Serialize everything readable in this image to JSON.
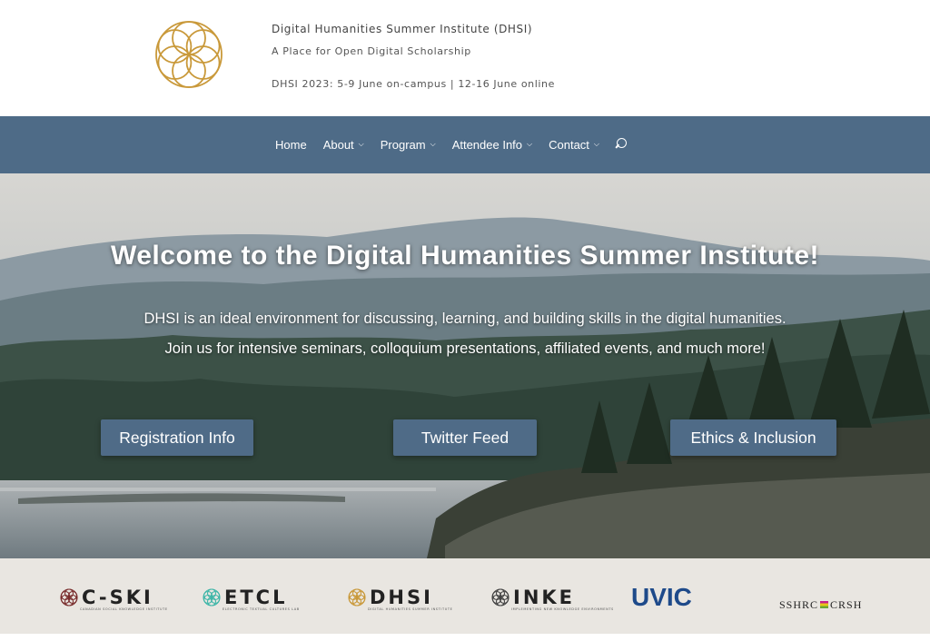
{
  "header": {
    "title": "Digital Humanities Summer Institute (DHSI)",
    "tagline": "A Place for Open Digital Scholarship",
    "dates": "DHSI 2023: 5-9 June on-campus | 12-16 June online",
    "logo_icon": "flower-of-life-logo-icon",
    "logo_color": "#c9993a"
  },
  "nav": {
    "background": "#4e6b87",
    "items": [
      {
        "label": "Home",
        "dropdown": false
      },
      {
        "label": "About",
        "dropdown": true
      },
      {
        "label": "Program",
        "dropdown": true
      },
      {
        "label": "Attendee Info",
        "dropdown": true
      },
      {
        "label": "Contact",
        "dropdown": true
      }
    ],
    "search_icon": "search-icon"
  },
  "hero": {
    "title": "Welcome to the Digital Humanities Summer Institute!",
    "line1": "DHSI is an ideal environment for discussing, learning, and building skills in the digital humanities.",
    "line2": "Join us for intensive seminars, colloquium presentations, affiliated events, and much more!",
    "buttons": {
      "registration": "Registration Info",
      "twitter": "Twitter Feed",
      "ethics": "Ethics & Inclusion"
    },
    "button_color": "#4f6b87"
  },
  "partners": {
    "cski": {
      "name": "C-SKI",
      "sub": "CANADIAN SOCIAL KNOWLEDGE INSTITUTE"
    },
    "etcl": {
      "name": "ETCL",
      "sub": "ELECTRONIC TEXTUAL CULTURES LAB"
    },
    "dhsi": {
      "name": "DHSI",
      "sub": "DIGITAL HUMANITIES SUMMER INSTITUTE"
    },
    "inke": {
      "name": "INKE",
      "sub": "IMPLEMENTING NEW KNOWLEDGE ENVIRONMENTS"
    },
    "uvic": {
      "name": "UVIC"
    },
    "sshrc": {
      "left": "SSHRC",
      "right": "CRSH"
    },
    "background": "#e9e6e1"
  }
}
